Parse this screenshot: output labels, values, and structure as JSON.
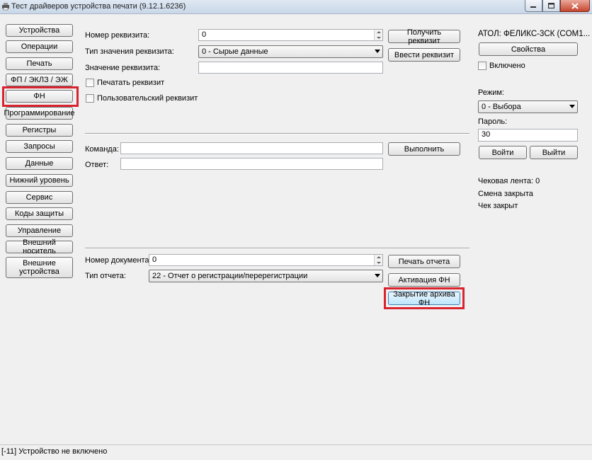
{
  "window": {
    "title": "Тест драйверов устройства печати (9.12.1.6236)"
  },
  "sidebar": {
    "items": [
      {
        "label": "Устройства"
      },
      {
        "label": "Операции"
      },
      {
        "label": "Печать"
      },
      {
        "label": "ФП / ЭКЛЗ / ЭЖ"
      },
      {
        "label": "ФН"
      },
      {
        "label": "Программирование"
      },
      {
        "label": "Регистры"
      },
      {
        "label": "Запросы"
      },
      {
        "label": "Данные"
      },
      {
        "label": "Нижний уровень"
      },
      {
        "label": "Сервис"
      },
      {
        "label": "Коды защиты"
      },
      {
        "label": "Управление"
      },
      {
        "label": "Внешний носитель"
      },
      {
        "label": "Внешние устройства"
      }
    ]
  },
  "requisite": {
    "number_label": "Номер реквизита:",
    "number_value": "0",
    "type_label": "Тип значения реквизита:",
    "type_value": "0 - Сырые данные",
    "value_label": "Значение реквизита:",
    "value_value": "",
    "print_label": "Печатать реквизит",
    "user_label": "Пользовательский реквизит",
    "get_button": "Получить реквизит",
    "enter_button": "Ввести реквизит"
  },
  "command": {
    "command_label": "Команда:",
    "command_value": "",
    "answer_label": "Ответ:",
    "answer_value": "",
    "execute_button": "Выполнить"
  },
  "report": {
    "doc_number_label": "Номер документа:",
    "doc_number_value": "0",
    "type_label": "Тип отчета:",
    "type_value": "22 - Отчет о регистрации/перерегистрации",
    "print_button": "Печать отчета",
    "activate_button": "Активация ФН",
    "close_archive_button": "Закрытие архива ФН"
  },
  "device": {
    "name": "АТОЛ: ФЕЛИКС-3СК (COM1...",
    "properties_button": "Свойства",
    "enabled_label": "Включено",
    "mode_label": "Режим:",
    "mode_value": "0 - Выбора",
    "password_label": "Пароль:",
    "password_value": "30",
    "login_button": "Войти",
    "logout_button": "Выйти",
    "receipt_tape": "Чековая лента: 0",
    "shift_status": "Смена закрыта",
    "receipt_status": "Чек закрыт"
  },
  "status": {
    "text": "[-11] Устройство не включено"
  },
  "colors": {
    "highlight": "#d9232e"
  }
}
